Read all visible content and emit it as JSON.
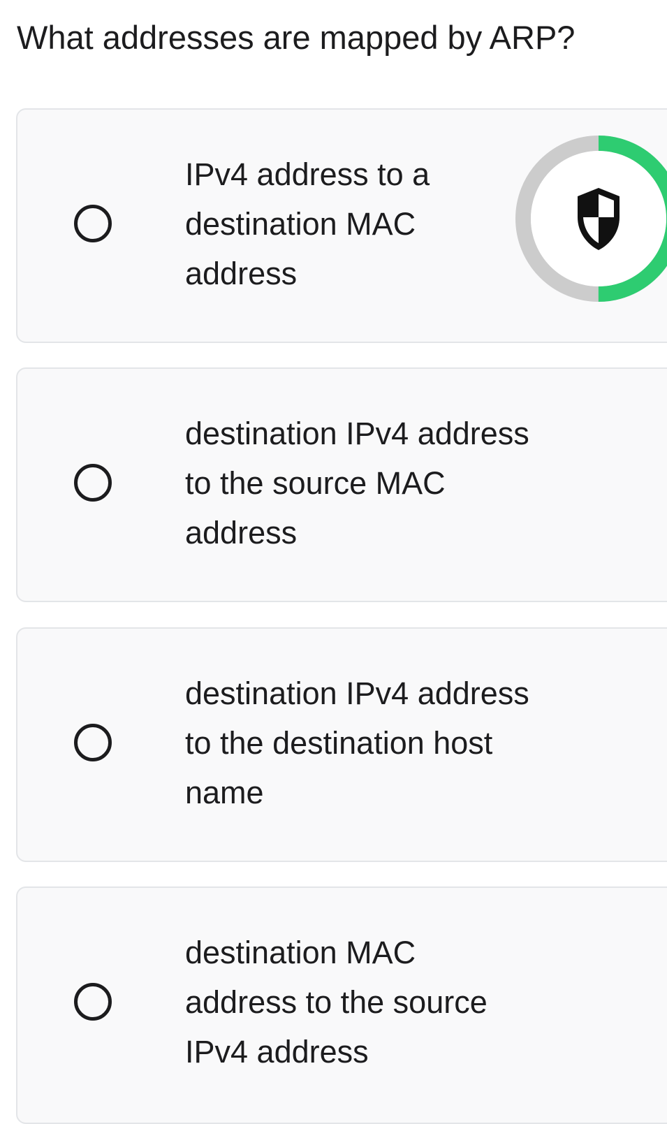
{
  "question": "What addresses are mapped by ARP?",
  "options": [
    {
      "label": "IPv4 address to a destination MAC address"
    },
    {
      "label": "destination IPv4 address to the source MAC address"
    },
    {
      "label": "destination IPv4 address to the destination host name"
    },
    {
      "label": "destination MAC address to the source IPv4 address"
    }
  ],
  "badge": {
    "icon": "shield-icon",
    "progress_fraction": 0.5,
    "progress_color": "#2ecc71",
    "track_color": "#cccccc"
  },
  "colors": {
    "card_background": "#f9f9fa",
    "card_border": "#e3e5e8",
    "text": "#1c1c1e"
  }
}
